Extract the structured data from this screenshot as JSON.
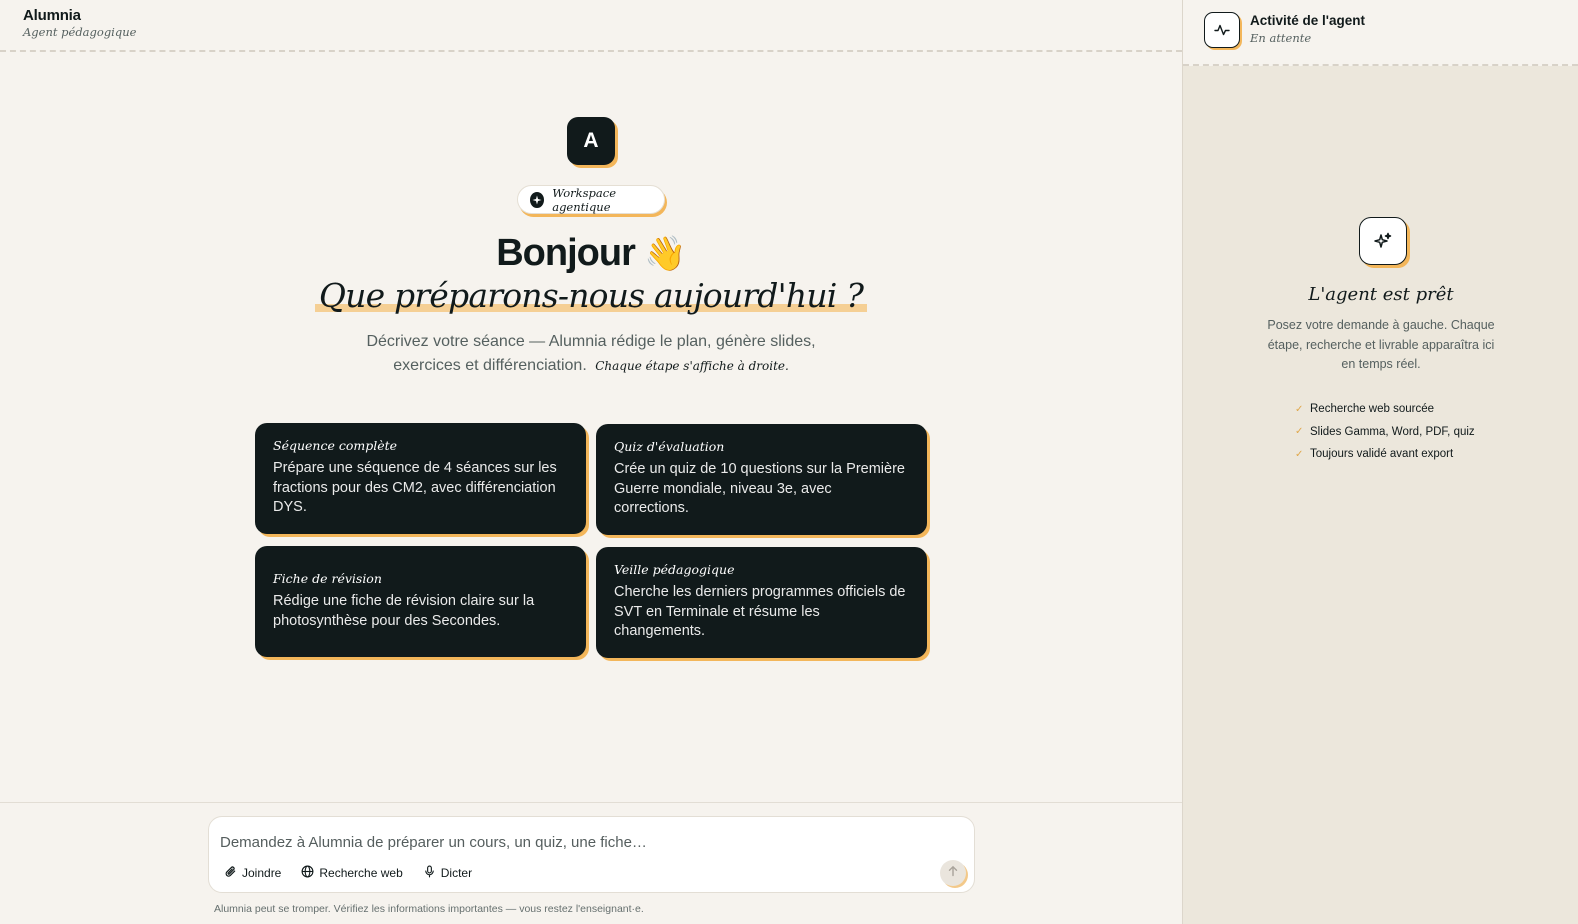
{
  "header": {
    "brand": "Alumnia",
    "subtitle": "Agent pédagogique"
  },
  "hero": {
    "logo_letter": "A",
    "pill_label": "Workspace agentique",
    "greeting": "Bonjour",
    "greeting_emoji": "👋",
    "question": "Que préparons-nous aujourd'hui ?",
    "description": "Décrivez votre séance — Alumnia rédige le plan, génère slides, exercices et différenciation.",
    "description_note": "Chaque étape s'affiche à droite."
  },
  "cards": [
    {
      "title": "Séquence complète",
      "text": "Prépare une séquence de 4 séances sur les fractions pour des CM2, avec différenciation DYS."
    },
    {
      "title": "Quiz d'évaluation",
      "text": "Crée un quiz de 10 questions sur la Première Guerre mondiale, niveau 3e, avec corrections."
    },
    {
      "title": "Fiche de révision",
      "text": "Rédige une fiche de révision claire sur la photosynthèse pour des Secondes."
    },
    {
      "title": "Veille pédagogique",
      "text": "Cherche les derniers programmes officiels de SVT en Terminale et résume les changements."
    }
  ],
  "composer": {
    "placeholder": "Demandez à Alumnia de préparer un cours, un quiz, une fiche…",
    "tools": {
      "attach": "Joindre",
      "web": "Recherche web",
      "dictate": "Dicter"
    },
    "disclaimer": "Alumnia peut se tromper. Vérifiez les informations importantes — vous restez l'enseignant·e."
  },
  "activity": {
    "title": "Activité de l'agent",
    "status": "En attente",
    "ready_title": "L'agent est prêt",
    "ready_desc": "Posez votre demande à gauche. Chaque étape, recherche et livrable apparaîtra ici en temps réel.",
    "features": [
      "Recherche web sourcée",
      "Slides Gamma, Word, PDF, quiz",
      "Toujours validé avant export"
    ]
  },
  "colors": {
    "accent": "#f3b65a",
    "dark": "#111a1b",
    "background": "#f6f3ee",
    "panel": "#ece7dc"
  }
}
